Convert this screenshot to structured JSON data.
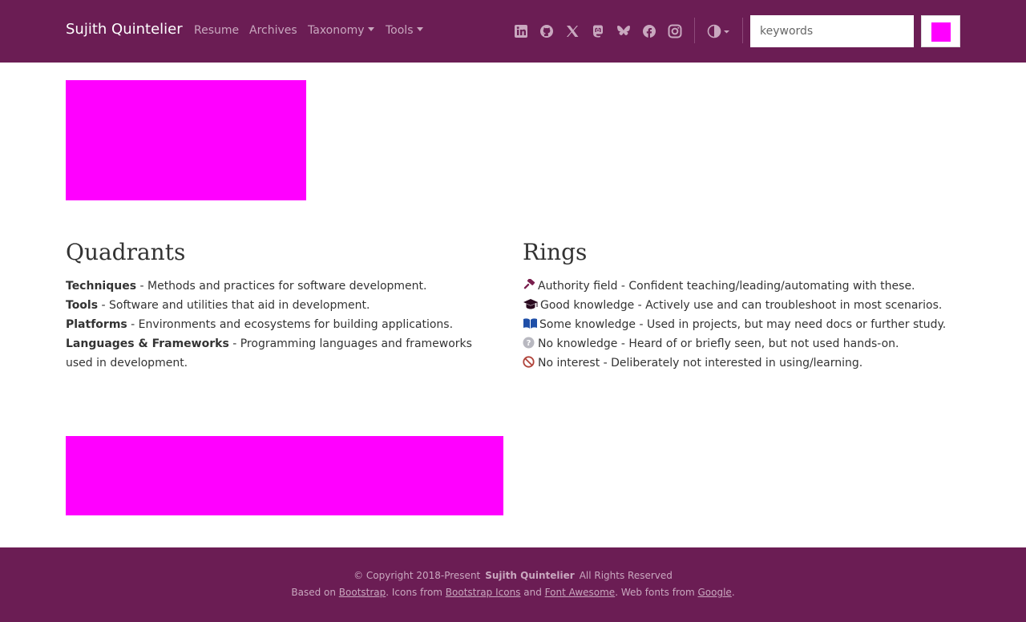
{
  "colors": {
    "brand": "#6b1d54",
    "nav_text": "#c9a8bf",
    "placeholder_image": "#ff00ff"
  },
  "navbar": {
    "brand": "Sujith Quintelier",
    "links": [
      {
        "label": "Resume"
      },
      {
        "label": "Archives"
      },
      {
        "label": "Taxonomy",
        "dropdown": true
      },
      {
        "label": "Tools",
        "dropdown": true
      }
    ],
    "social_icons": [
      "linkedin-icon",
      "github-icon",
      "x-icon",
      "mastodon-icon",
      "bluesky-icon",
      "facebook-icon",
      "instagram-icon"
    ],
    "theme_icon": "contrast-icon",
    "search": {
      "placeholder": "keywords",
      "value": ""
    }
  },
  "quadrants": {
    "title": "Quadrants",
    "items": [
      {
        "term": "Techniques",
        "desc": " - Methods and practices for software development."
      },
      {
        "term": "Tools",
        "desc": " - Software and utilities that aid in development."
      },
      {
        "term": "Platforms",
        "desc": " - Environments and ecosystems for building applications."
      },
      {
        "term": "Languages & Frameworks",
        "desc": " - Programming languages and frameworks used in development."
      }
    ]
  },
  "rings": {
    "title": "Rings",
    "items": [
      {
        "icon": "gavel-icon",
        "text": "Authority field - Confident teaching/leading/automating with these."
      },
      {
        "icon": "graduation-cap-icon",
        "text": "Good knowledge - Actively use and can troubleshoot in most scenarios."
      },
      {
        "icon": "open-book-icon",
        "text": "Some knowledge - Used in projects, but may need docs or further study."
      },
      {
        "icon": "question-circle-icon",
        "text": "No knowledge - Heard of or briefly seen, but not used hands-on."
      },
      {
        "icon": "ban-icon",
        "text": "No interest - Deliberately not interested in using/learning."
      }
    ]
  },
  "footer": {
    "copyright": "© Copyright 2018-Present",
    "owner": "Sujith Quintelier",
    "rights": "All Rights Reserved",
    "based_on": "Based on ",
    "bootstrap": "Bootstrap",
    "icons_from": ". Icons from ",
    "bootstrap_icons": "Bootstrap Icons",
    "and": " and ",
    "font_awesome": "Font Awesome",
    "web_fonts": ". Web fonts from ",
    "google": "Google",
    "end": "."
  }
}
